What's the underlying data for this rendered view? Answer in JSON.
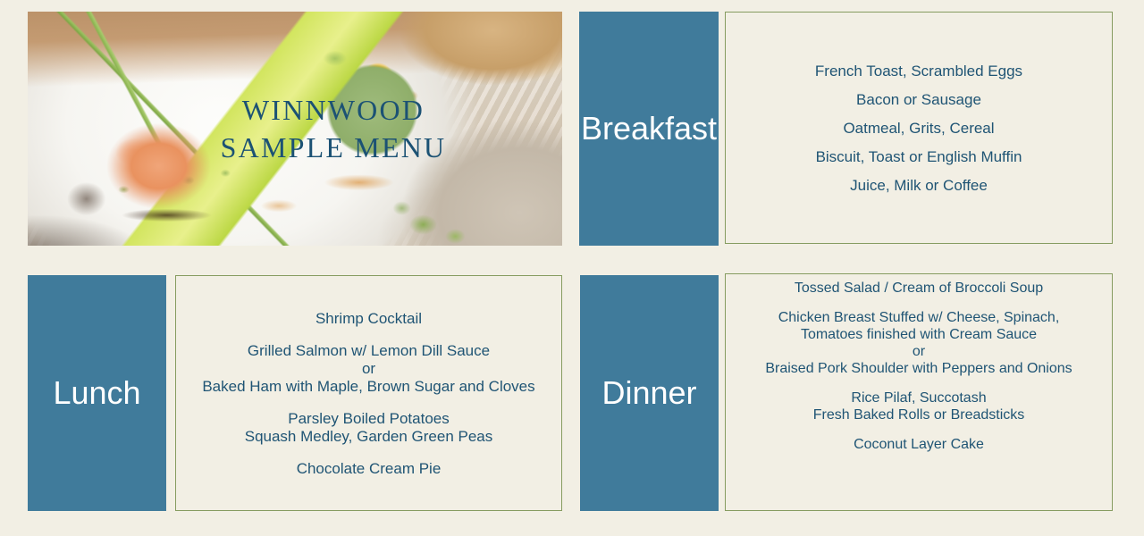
{
  "page": {
    "background_color": "#F2EFE4",
    "accent_blue": "#407B9B",
    "text_blue": "#1F5474",
    "border_green": "#869C60"
  },
  "hero": {
    "title_line1": "WINNWOOD",
    "title_line2": "SAMPLE MENU",
    "photo_name": "plated-food-photo",
    "photo_description": "Salmon tartare with lime wedge and chives beside beef tartare in a cucumber ring topped with egg yolk, on a white plate with rustic bread and a knit napkin"
  },
  "meals": [
    {
      "id": "breakfast",
      "label": "Breakfast",
      "lines": [
        "French Toast, Scrambled Eggs",
        "Bacon or Sausage",
        "Oatmeal, Grits, Cereal",
        "Biscuit, Toast or English Muffin",
        "Juice, Milk or Coffee"
      ]
    },
    {
      "id": "lunch",
      "label": "Lunch",
      "lines": [
        "Shrimp Cocktail",
        "",
        "Grilled Salmon w/ Lemon Dill Sauce",
        "or",
        "Baked Ham with Maple, Brown Sugar and Cloves",
        "",
        "Parsley Boiled Potatoes",
        "Squash Medley, Garden Green Peas",
        "",
        "Chocolate Cream Pie"
      ]
    },
    {
      "id": "dinner",
      "label": "Dinner",
      "lines": [
        "Tossed Salad / Cream of Broccoli Soup",
        "",
        "Chicken Breast Stuffed w/ Cheese, Spinach,",
        "Tomatoes finished with  Cream Sauce",
        "or",
        "Braised Pork Shoulder with Peppers and Onions",
        "",
        "Rice Pilaf, Succotash",
        "Fresh Baked Rolls or Breadsticks",
        "",
        "Coconut Layer Cake"
      ]
    }
  ]
}
